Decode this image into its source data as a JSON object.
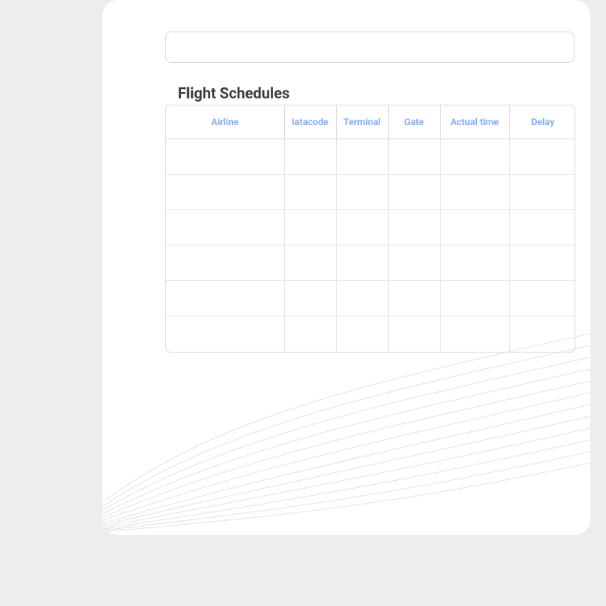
{
  "search": {
    "placeholder": ""
  },
  "section_title": "Flight Schedules",
  "table": {
    "columns": [
      "Airline",
      "Iatacode",
      "Terminal",
      "Gate",
      "Actual time",
      "Delay"
    ],
    "rows": [
      {
        "airline": "",
        "iatacode": "",
        "terminal": "",
        "gate": "",
        "actual_time": "",
        "delay": ""
      },
      {
        "airline": "",
        "iatacode": "",
        "terminal": "",
        "gate": "",
        "actual_time": "",
        "delay": ""
      },
      {
        "airline": "",
        "iatacode": "",
        "terminal": "",
        "gate": "",
        "actual_time": "",
        "delay": ""
      },
      {
        "airline": "",
        "iatacode": "",
        "terminal": "",
        "gate": "",
        "actual_time": "",
        "delay": ""
      },
      {
        "airline": "",
        "iatacode": "",
        "terminal": "",
        "gate": "",
        "actual_time": "",
        "delay": ""
      },
      {
        "airline": "",
        "iatacode": "",
        "terminal": "",
        "gate": "",
        "actual_time": "",
        "delay": ""
      }
    ]
  }
}
